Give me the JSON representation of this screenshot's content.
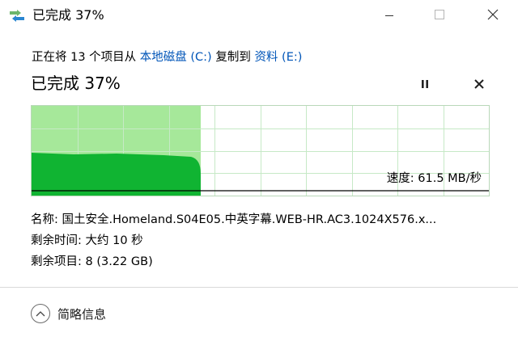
{
  "window": {
    "title": "已完成 37%"
  },
  "header": {
    "prefix": "正在将 13 个项目从 ",
    "source": "本地磁盘 (C:)",
    "middle": " 复制到 ",
    "destination": "资料 (E:)"
  },
  "status": {
    "title": "已完成 37%"
  },
  "progress": {
    "percent": 37
  },
  "graph": {
    "speed_label": "速度: 61.5 MB/秒",
    "completed_color": "#a6e89a",
    "speed_fill_color": "#10b432",
    "grid_color": "#c6e9c6"
  },
  "details": {
    "name_label": "名称: ",
    "name_value": "国土安全.Homeland.S04E05.中英字幕.WEB-HR.AC3.1024X576.x...",
    "time_label": "剩余时间: ",
    "time_value": "大约 10 秒",
    "items_label": "剩余项目: ",
    "items_value": "8 (3.22 GB)"
  },
  "footer": {
    "toggle_label": "简略信息"
  },
  "icons": [
    "copy-arrows-icon",
    "minimize-icon",
    "maximize-icon",
    "close-icon",
    "pause-icon",
    "cancel-icon",
    "chevron-up-icon"
  ]
}
